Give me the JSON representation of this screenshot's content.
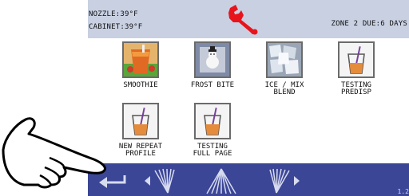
{
  "status": {
    "nozzle": "NOZZLE:39°F",
    "cabinet": "CABINET:39°F",
    "zone": "ZONE 2 DUE:6 DAYS",
    "service_icon": "wrench-icon",
    "service_color": "#e8141b"
  },
  "menu": {
    "items": [
      {
        "label": "SMOOTHIE",
        "icon": "smoothie-image"
      },
      {
        "label": "FROST BITE",
        "icon": "frost-bite-image"
      },
      {
        "label": "ICE / MIX\nBLEND",
        "icon": "ice-image"
      },
      {
        "label": "TESTING\nPREDISP",
        "icon": "cup-icon"
      },
      {
        "label": "NEW REPEAT\nPROFILE",
        "icon": "cup-icon"
      },
      {
        "label": "TESTING\nFULL PAGE",
        "icon": "cup-icon"
      }
    ]
  },
  "navbar": {
    "back_icon": "back-arrow-icon",
    "prev_icon": "prev-page-icon",
    "up_icon": "up-icon",
    "next_icon": "next-page-icon",
    "version": "1.2",
    "color": "#3b4696"
  },
  "overlay": {
    "icon": "pointing-hand-icon"
  }
}
